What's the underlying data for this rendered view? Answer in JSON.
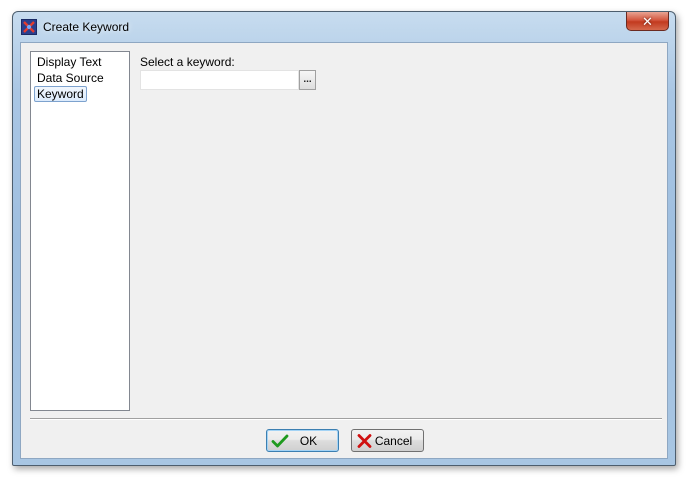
{
  "window": {
    "title": "Create Keyword",
    "close_glyph": "✕"
  },
  "nav": {
    "items": [
      {
        "label": "Display Text",
        "selected": false
      },
      {
        "label": "Data Source",
        "selected": false
      },
      {
        "label": "Keyword",
        "selected": true
      }
    ]
  },
  "keyword": {
    "label": "Select a keyword:",
    "value": "",
    "browse_label": "..."
  },
  "buttons": {
    "ok_label": "OK",
    "ok_icon": "checkmark-icon",
    "cancel_label": "Cancel",
    "cancel_icon": "red-x-icon"
  },
  "colors": {
    "frame": "#a9c6e4",
    "client_bg": "#f0f0f0",
    "close_button": "#c23a1f",
    "check_green": "#1e9a1e",
    "cancel_red": "#d01010"
  }
}
